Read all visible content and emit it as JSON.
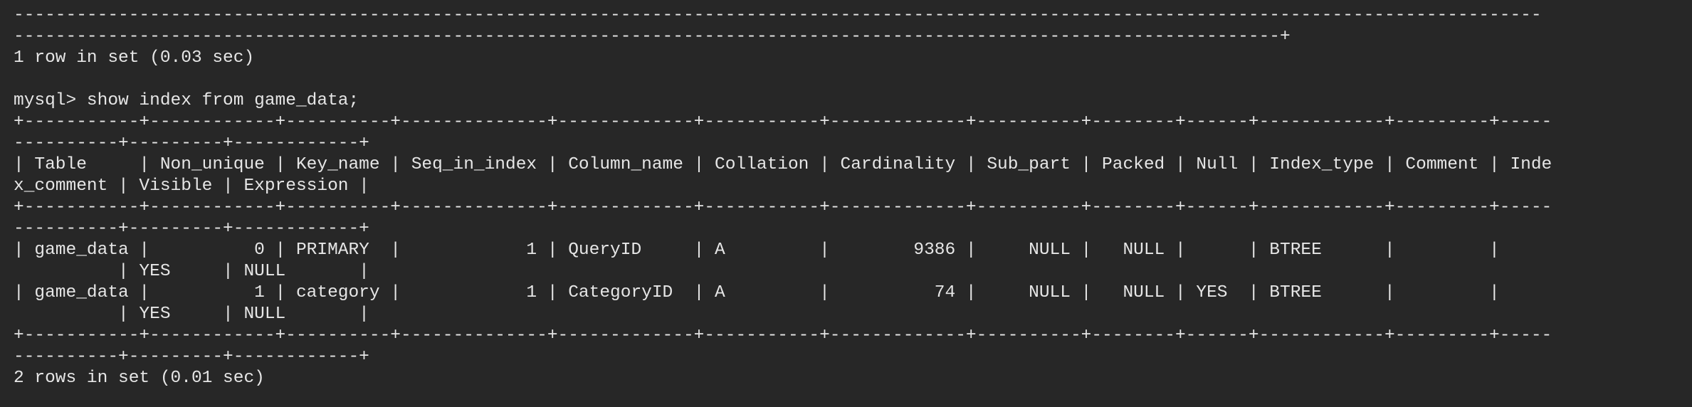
{
  "terminal": {
    "lines": [
      "--------------------------------------------------------------------------------------------------------------------------------------------------",
      "-------------------------------------------------------------------------------------------------------------------------+",
      "1 row in set (0.03 sec)",
      "",
      "mysql> show index from game_data;",
      "+-----------+------------+----------+--------------+-------------+-----------+-------------+----------+--------+------+------------+---------+-----",
      "----------+---------+------------+",
      "| Table     | Non_unique | Key_name | Seq_in_index | Column_name | Collation | Cardinality | Sub_part | Packed | Null | Index_type | Comment | Inde",
      "x_comment | Visible | Expression |",
      "+-----------+------------+----------+--------------+-------------+-----------+-------------+----------+--------+------+------------+---------+-----",
      "----------+---------+------------+",
      "| game_data |          0 | PRIMARY  |            1 | QueryID     | A         |        9386 |     NULL |   NULL |      | BTREE      |         |",
      "          | YES     | NULL       |",
      "| game_data |          1 | category |            1 | CategoryID  | A         |          74 |     NULL |   NULL | YES  | BTREE      |         |",
      "          | YES     | NULL       |",
      "+-----------+------------+----------+--------------+-------------+-----------+-------------+----------+--------+------+------------+---------+-----",
      "----------+---------+------------+",
      "2 rows in set (0.01 sec)"
    ]
  }
}
